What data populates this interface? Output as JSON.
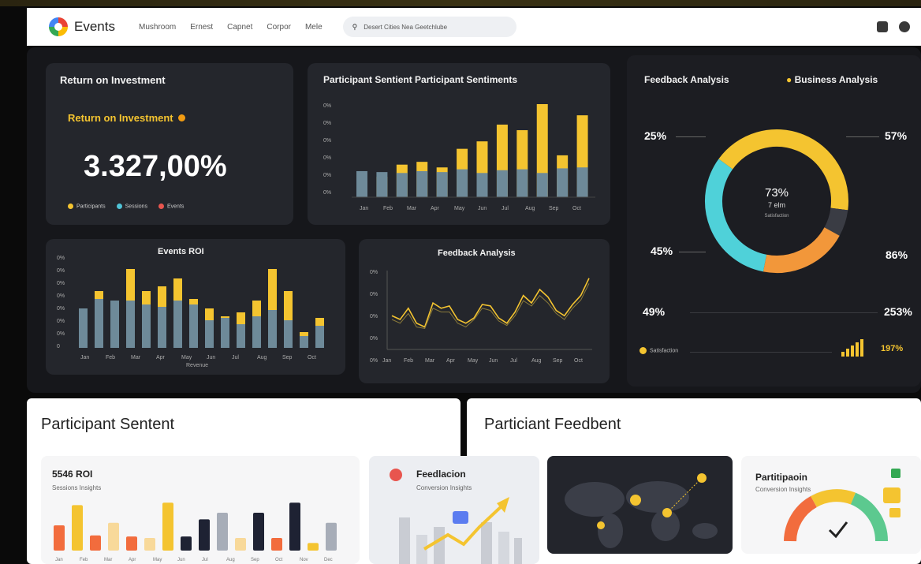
{
  "nav": {
    "brand": "Events",
    "links": [
      "Mushroom",
      "Ernest",
      "Capnet",
      "Corpor",
      "Mele"
    ],
    "search": "Desert Cities Nea Geetchlube"
  },
  "roi_card": {
    "title": "Return on Investment",
    "subtitle": "Return on Investment",
    "value": "3.327,00%",
    "legend": [
      "Participants",
      "Sessions",
      "Events"
    ]
  },
  "sentiment_card": {
    "title": "Participant Sentient Participant Sentiments",
    "y_ticks": [
      "0%",
      "0%",
      "0%",
      "0%",
      "0%",
      "0%"
    ],
    "x_ticks": [
      "Jan",
      "Feb",
      "Mar",
      "Apr",
      "May",
      "Jun",
      "Jul",
      "Aug",
      "Sep",
      "Oct"
    ]
  },
  "events_roi_card": {
    "title": "Events ROI",
    "y_ticks": [
      "0%",
      "0%",
      "0%",
      "0%",
      "0%",
      "0%",
      "0%",
      "0"
    ],
    "x_ticks": [
      "Jan",
      "Feb",
      "Mar",
      "Apr",
      "May",
      "Jun",
      "Jul",
      "Aug",
      "Sep",
      "Oct"
    ],
    "x_note": "Revenue"
  },
  "feedback_line_card": {
    "title": "Feedback Analysis",
    "y_ticks": [
      "0%",
      "0%",
      "0%",
      "0%",
      "0%"
    ],
    "x_ticks": [
      "Jan",
      "Feb",
      "Mar",
      "Apr",
      "May",
      "Jun",
      "Jul",
      "Aug",
      "Sep",
      "Oct"
    ]
  },
  "donut_card": {
    "title": "Feedback Analysis",
    "tag": "Business Analysis",
    "labels": {
      "top_left": "25%",
      "top_right": "57%",
      "mid_left": "45%",
      "mid_right": "86%",
      "bottom_left": "49%",
      "bottom_right": "253%"
    },
    "center_value": "73%",
    "center_sub": "7 elm",
    "center_note": "Satisfaction",
    "legend": "Satisfaction",
    "footer_value": "197%"
  },
  "lower": {
    "left_title": "Participant Sentent",
    "right_title": "Particiant Feedbent",
    "roi_card": {
      "title": "5546 ROI",
      "sub": "Sessions Insights",
      "x_ticks": [
        "Jan",
        "Feb",
        "Mar",
        "Apr",
        "May",
        "Jun",
        "Jul",
        "Aug",
        "Sep",
        "Oct",
        "Nov",
        "Dec"
      ]
    },
    "feedback_card": {
      "title": "Feedlacion",
      "sub": "Conversion Insights"
    },
    "participation_card": {
      "title": "Partitipaoin",
      "sub": "Conversion Insights"
    }
  },
  "chart_data": [
    {
      "type": "bar",
      "title": "Participant Sentient Participant Sentiments",
      "series": [
        {
          "values": [
            0.18,
            0.22,
            0.35,
            0.38,
            0.32,
            0.52,
            0.6,
            0.78,
            0.72,
            1.0,
            0.45,
            0.88
          ]
        },
        {
          "values": [
            0.28,
            0.27,
            0.26,
            0.28,
            0.27,
            0.3,
            0.26,
            0.29,
            0.3,
            0.26,
            0.31,
            0.32
          ]
        }
      ]
    },
    {
      "type": "bar",
      "title": "Events ROI",
      "series": [
        {
          "values": [
            0.5,
            0.72,
            0.6,
            1.0,
            0.72,
            0.78,
            0.88,
            0.62,
            0.5,
            0.4,
            0.45,
            0.6,
            1.0,
            0.72,
            0.2,
            0.38
          ]
        },
        {
          "values": [
            0.5,
            0.62,
            0.6,
            0.6,
            0.55,
            0.52,
            0.6,
            0.55,
            0.35,
            0.38,
            0.3,
            0.4,
            0.48,
            0.35,
            0.15,
            0.28
          ]
        }
      ]
    },
    {
      "type": "line",
      "title": "Feedback Analysis",
      "series": [
        {
          "values": [
            0.45,
            0.4,
            0.55,
            0.35,
            0.3,
            0.62,
            0.55,
            0.58,
            0.4,
            0.35,
            0.42,
            0.6,
            0.58,
            0.42,
            0.35,
            0.5,
            0.72,
            0.62,
            0.8,
            0.7,
            0.52,
            0.45,
            0.6,
            0.72,
            0.95
          ]
        },
        {
          "values": [
            0.4,
            0.35,
            0.48,
            0.3,
            0.28,
            0.55,
            0.5,
            0.5,
            0.35,
            0.3,
            0.4,
            0.55,
            0.52,
            0.38,
            0.32,
            0.45,
            0.65,
            0.58,
            0.72,
            0.62,
            0.48,
            0.4,
            0.55,
            0.66,
            0.88
          ]
        }
      ]
    },
    {
      "type": "pie",
      "title": "Feedback Analysis",
      "slices": [
        {
          "value": 42
        },
        {
          "value": 6
        },
        {
          "value": 20
        },
        {
          "value": 32
        }
      ]
    }
  ]
}
